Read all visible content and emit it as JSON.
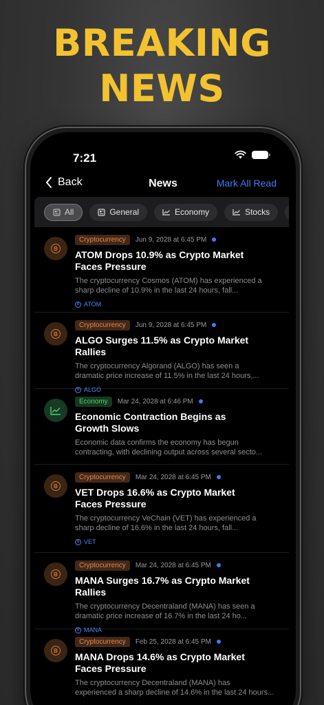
{
  "promo": {
    "line1": "BREAKING",
    "line2": "NEWS"
  },
  "status": {
    "time": "7:21"
  },
  "nav": {
    "back_label": "Back",
    "title": "News",
    "mark_all": "Mark All Read"
  },
  "filters": [
    {
      "label": "All",
      "icon": "layers-icon",
      "active": true
    },
    {
      "label": "General",
      "icon": "newspaper-icon",
      "active": false
    },
    {
      "label": "Economy",
      "icon": "chart-line-icon",
      "active": false
    },
    {
      "label": "Stocks",
      "icon": "chart-line-icon",
      "active": false
    },
    {
      "label": "",
      "icon": "bitcoin-icon",
      "active": false
    }
  ],
  "news": [
    {
      "category": "Cryptocurrency",
      "date": "Jun 9, 2028 at 6:45 PM",
      "title_line1": "ATOM Drops 10.9% as Crypto Market",
      "title_line2": "Faces Pressure",
      "desc_line1": "The cryptocurrency Cosmos (ATOM) has experienced a",
      "desc_line2": "sharp decline of 10.9% in the last 24 hours, fall...",
      "tag": "ATOM"
    },
    {
      "category": "Cryptocurrency",
      "date": "Jun 9, 2028 at 6:45 PM",
      "title_line1": "ALGO Surges 11.5% as Crypto Market Rallies",
      "title_line2": "",
      "desc_line1": "The cryptocurrency Algorand (ALGO) has seen a",
      "desc_line2": "dramatic price increase of 11.5% in the last 24 hours,...",
      "tag": "ALGO"
    },
    {
      "category": "Economy",
      "date": "Mar 24, 2028 at 6:46 PM",
      "title_line1": "Economic Contraction Begins as",
      "title_line2": "Growth Slows",
      "desc_line1": "Economic data confirms the economy has begun",
      "desc_line2": "contracting, with declining output across several secto...",
      "tag": ""
    },
    {
      "category": "Cryptocurrency",
      "date": "Mar 24, 2028 at 6:45 PM",
      "title_line1": "VET Drops 16.6% as Crypto Market",
      "title_line2": "Faces Pressure",
      "desc_line1": "The cryptocurrency VeChain (VET) has experienced a",
      "desc_line2": "sharp decline of 16.6% in the last 24 hours, fall...",
      "tag": "VET"
    },
    {
      "category": "Cryptocurrency",
      "date": "Mar 24, 2028 at 6:45 PM",
      "title_line1": "MANA Surges 16.7% as Crypto Market Rallies",
      "title_line2": "",
      "desc_line1": "The cryptocurrency Decentraland (MANA) has seen a",
      "desc_line2": "dramatic price increase of 16.7% in the last 24 ho...",
      "tag": "MANA"
    },
    {
      "category": "Cryptocurrency",
      "date": "Feb 25, 2028 at 6:45 PM",
      "title_line1": "MANA Drops 14.6% as Crypto Market",
      "title_line2": "Faces Pressure",
      "desc_line1": "The cryptocurrency Decentraland (MANA) has",
      "desc_line2": "experienced a sharp decline of 14.6% in the last 24 hours...",
      "tag": ""
    }
  ],
  "colors": {
    "accent": "#3d7ff5",
    "promo": "#f2c230",
    "crypto": "#e48a4a",
    "economy": "#4fce73"
  }
}
